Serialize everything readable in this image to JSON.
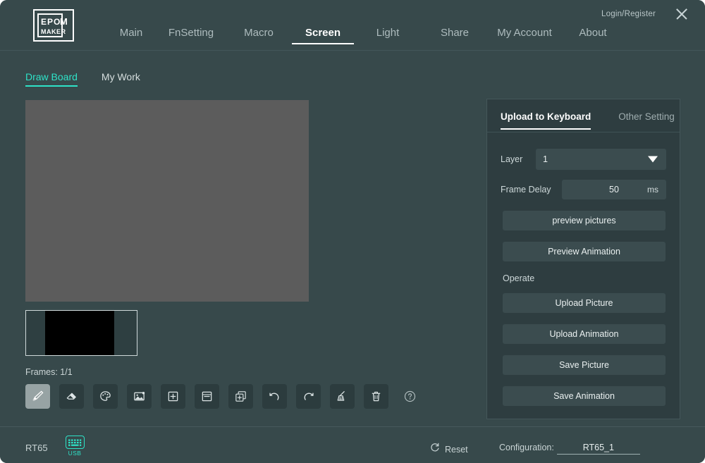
{
  "window": {
    "login_label": "Login/Register",
    "close_icon": "close-icon",
    "logo_line1": "EPOM",
    "logo_line2": "MAKER"
  },
  "nav": {
    "items": [
      {
        "label": "Main",
        "active": false
      },
      {
        "label": "FnSetting",
        "active": false
      },
      {
        "label": "Macro",
        "active": false
      },
      {
        "label": "Screen",
        "active": true
      },
      {
        "label": "Light",
        "active": false
      },
      {
        "label": "Share",
        "active": false
      },
      {
        "label": "My Account",
        "active": false
      },
      {
        "label": "About",
        "active": false
      }
    ]
  },
  "subtabs": {
    "items": [
      {
        "label": "Draw Board",
        "active": true
      },
      {
        "label": "My Work",
        "active": false
      }
    ]
  },
  "editor": {
    "frames_label": "Frames: 1/1",
    "canvas_color": "#5c5c5c",
    "thumb_color": "#000000",
    "tools": [
      {
        "name": "brush-icon",
        "selected": true
      },
      {
        "name": "eraser-icon",
        "selected": false
      },
      {
        "name": "palette-icon",
        "selected": false
      },
      {
        "name": "image-icon",
        "selected": false
      },
      {
        "name": "add-frame-icon",
        "selected": false
      },
      {
        "name": "remove-frame-icon",
        "selected": false
      },
      {
        "name": "copy-frame-icon",
        "selected": false
      },
      {
        "name": "undo-icon",
        "selected": false
      },
      {
        "name": "redo-icon",
        "selected": false
      },
      {
        "name": "clear-icon",
        "selected": false
      },
      {
        "name": "delete-icon",
        "selected": false
      },
      {
        "name": "help-icon",
        "selected": false
      }
    ]
  },
  "panel": {
    "tabs": [
      {
        "label": "Upload to Keyboard",
        "active": true
      },
      {
        "label": "Other Setting",
        "active": false
      }
    ],
    "layer_label": "Layer",
    "layer_value": "1",
    "layer_options": [
      "1"
    ],
    "frame_delay_label": "Frame Delay",
    "frame_delay_value": "50",
    "frame_delay_unit": "ms",
    "preview_pictures_label": "preview pictures",
    "preview_animation_label": "Preview Animation",
    "operate_label": "Operate",
    "upload_picture_label": "Upload Picture",
    "upload_animation_label": "Upload Animation",
    "save_picture_label": "Save Picture",
    "save_animation_label": "Save Animation"
  },
  "footer": {
    "device_name": "RT65",
    "connection_label": "USB",
    "reset_label": "Reset",
    "configuration_label": "Configuration:",
    "configuration_value": "RT65_1"
  },
  "colors": {
    "background": "#37494b",
    "panel": "#2e3d40",
    "accent": "#2ee3c8",
    "control": "#3b4c4f",
    "text": "#e7eeee",
    "muted": "#aebcbe"
  }
}
